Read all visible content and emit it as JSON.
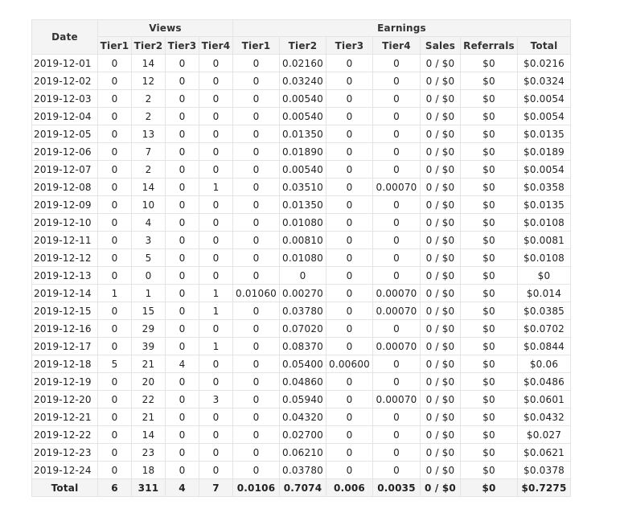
{
  "table": {
    "header": {
      "date_label": "Date",
      "views_label": "Views",
      "earnings_label": "Earnings",
      "view_columns": [
        "Tier1",
        "Tier2",
        "Tier3",
        "Tier4"
      ],
      "earning_columns": [
        "Tier1",
        "Tier2",
        "Tier3",
        "Tier4",
        "Sales",
        "Referrals",
        "Total"
      ]
    },
    "rows": [
      {
        "date": "2019-12-01",
        "views": [
          "0",
          "14",
          "0",
          "0"
        ],
        "earnings": [
          "0",
          "0.02160",
          "0",
          "0",
          "0 / $0",
          "$0",
          "$0.0216"
        ]
      },
      {
        "date": "2019-12-02",
        "views": [
          "0",
          "12",
          "0",
          "0"
        ],
        "earnings": [
          "0",
          "0.03240",
          "0",
          "0",
          "0 / $0",
          "$0",
          "$0.0324"
        ]
      },
      {
        "date": "2019-12-03",
        "views": [
          "0",
          "2",
          "0",
          "0"
        ],
        "earnings": [
          "0",
          "0.00540",
          "0",
          "0",
          "0 / $0",
          "$0",
          "$0.0054"
        ]
      },
      {
        "date": "2019-12-04",
        "views": [
          "0",
          "2",
          "0",
          "0"
        ],
        "earnings": [
          "0",
          "0.00540",
          "0",
          "0",
          "0 / $0",
          "$0",
          "$0.0054"
        ]
      },
      {
        "date": "2019-12-05",
        "views": [
          "0",
          "13",
          "0",
          "0"
        ],
        "earnings": [
          "0",
          "0.01350",
          "0",
          "0",
          "0 / $0",
          "$0",
          "$0.0135"
        ]
      },
      {
        "date": "2019-12-06",
        "views": [
          "0",
          "7",
          "0",
          "0"
        ],
        "earnings": [
          "0",
          "0.01890",
          "0",
          "0",
          "0 / $0",
          "$0",
          "$0.0189"
        ]
      },
      {
        "date": "2019-12-07",
        "views": [
          "0",
          "2",
          "0",
          "0"
        ],
        "earnings": [
          "0",
          "0.00540",
          "0",
          "0",
          "0 / $0",
          "$0",
          "$0.0054"
        ]
      },
      {
        "date": "2019-12-08",
        "views": [
          "0",
          "14",
          "0",
          "1"
        ],
        "earnings": [
          "0",
          "0.03510",
          "0",
          "0.00070",
          "0 / $0",
          "$0",
          "$0.0358"
        ]
      },
      {
        "date": "2019-12-09",
        "views": [
          "0",
          "10",
          "0",
          "0"
        ],
        "earnings": [
          "0",
          "0.01350",
          "0",
          "0",
          "0 / $0",
          "$0",
          "$0.0135"
        ]
      },
      {
        "date": "2019-12-10",
        "views": [
          "0",
          "4",
          "0",
          "0"
        ],
        "earnings": [
          "0",
          "0.01080",
          "0",
          "0",
          "0 / $0",
          "$0",
          "$0.0108"
        ]
      },
      {
        "date": "2019-12-11",
        "views": [
          "0",
          "3",
          "0",
          "0"
        ],
        "earnings": [
          "0",
          "0.00810",
          "0",
          "0",
          "0 / $0",
          "$0",
          "$0.0081"
        ]
      },
      {
        "date": "2019-12-12",
        "views": [
          "0",
          "5",
          "0",
          "0"
        ],
        "earnings": [
          "0",
          "0.01080",
          "0",
          "0",
          "0 / $0",
          "$0",
          "$0.0108"
        ]
      },
      {
        "date": "2019-12-13",
        "views": [
          "0",
          "0",
          "0",
          "0"
        ],
        "earnings": [
          "0",
          "0",
          "0",
          "0",
          "0 / $0",
          "$0",
          "$0"
        ]
      },
      {
        "date": "2019-12-14",
        "views": [
          "1",
          "1",
          "0",
          "1"
        ],
        "earnings": [
          "0.01060",
          "0.00270",
          "0",
          "0.00070",
          "0 / $0",
          "$0",
          "$0.014"
        ]
      },
      {
        "date": "2019-12-15",
        "views": [
          "0",
          "15",
          "0",
          "1"
        ],
        "earnings": [
          "0",
          "0.03780",
          "0",
          "0.00070",
          "0 / $0",
          "$0",
          "$0.0385"
        ]
      },
      {
        "date": "2019-12-16",
        "views": [
          "0",
          "29",
          "0",
          "0"
        ],
        "earnings": [
          "0",
          "0.07020",
          "0",
          "0",
          "0 / $0",
          "$0",
          "$0.0702"
        ]
      },
      {
        "date": "2019-12-17",
        "views": [
          "0",
          "39",
          "0",
          "1"
        ],
        "earnings": [
          "0",
          "0.08370",
          "0",
          "0.00070",
          "0 / $0",
          "$0",
          "$0.0844"
        ]
      },
      {
        "date": "2019-12-18",
        "views": [
          "5",
          "21",
          "4",
          "0"
        ],
        "earnings": [
          "0",
          "0.05400",
          "0.00600",
          "0",
          "0 / $0",
          "$0",
          "$0.06"
        ]
      },
      {
        "date": "2019-12-19",
        "views": [
          "0",
          "20",
          "0",
          "0"
        ],
        "earnings": [
          "0",
          "0.04860",
          "0",
          "0",
          "0 / $0",
          "$0",
          "$0.0486"
        ]
      },
      {
        "date": "2019-12-20",
        "views": [
          "0",
          "22",
          "0",
          "3"
        ],
        "earnings": [
          "0",
          "0.05940",
          "0",
          "0.00070",
          "0 / $0",
          "$0",
          "$0.0601"
        ]
      },
      {
        "date": "2019-12-21",
        "views": [
          "0",
          "21",
          "0",
          "0"
        ],
        "earnings": [
          "0",
          "0.04320",
          "0",
          "0",
          "0 / $0",
          "$0",
          "$0.0432"
        ]
      },
      {
        "date": "2019-12-22",
        "views": [
          "0",
          "14",
          "0",
          "0"
        ],
        "earnings": [
          "0",
          "0.02700",
          "0",
          "0",
          "0 / $0",
          "$0",
          "$0.027"
        ]
      },
      {
        "date": "2019-12-23",
        "views": [
          "0",
          "23",
          "0",
          "0"
        ],
        "earnings": [
          "0",
          "0.06210",
          "0",
          "0",
          "0 / $0",
          "$0",
          "$0.0621"
        ]
      },
      {
        "date": "2019-12-24",
        "views": [
          "0",
          "18",
          "0",
          "0"
        ],
        "earnings": [
          "0",
          "0.03780",
          "0",
          "0",
          "0 / $0",
          "$0",
          "$0.0378"
        ]
      }
    ],
    "totals": {
      "label": "Total",
      "views": [
        "6",
        "311",
        "4",
        "7"
      ],
      "earnings": [
        "0.0106",
        "0.7074",
        "0.006",
        "0.0035",
        "0 / $0",
        "$0",
        "$0.7275"
      ]
    }
  },
  "colors": {
    "header_bg": "#f4f4f4",
    "border": "#e4e4e4",
    "text": "#222222"
  }
}
